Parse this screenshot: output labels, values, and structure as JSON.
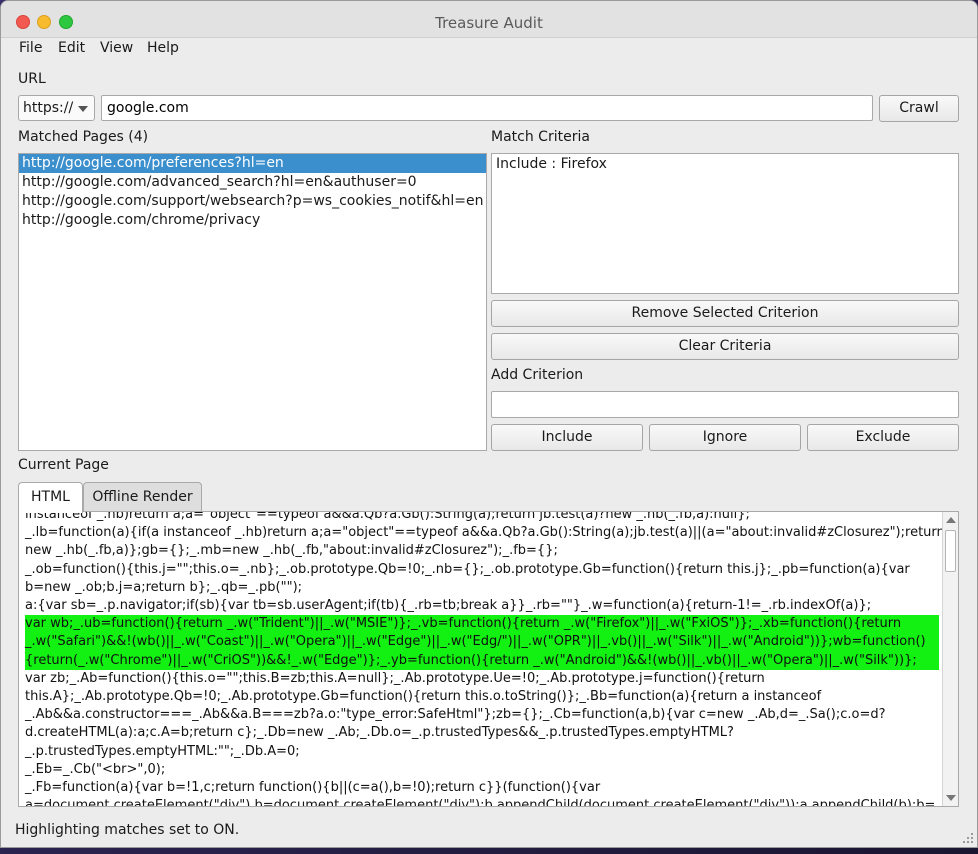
{
  "window": {
    "title": "Treasure Audit"
  },
  "menu": [
    "File",
    "Edit",
    "View",
    "Help"
  ],
  "url_section": {
    "label": "URL",
    "scheme": "https://",
    "value": "google.com",
    "crawl_label": "Crawl"
  },
  "matched": {
    "label": "Matched Pages (4)",
    "items": [
      "http://google.com/preferences?hl=en",
      "http://google.com/advanced_search?hl=en&authuser=0",
      "http://google.com/support/websearch?p=ws_cookies_notif&hl=en",
      "http://google.com/chrome/privacy"
    ],
    "selected_index": 0
  },
  "criteria": {
    "label": "Match Criteria",
    "items": [
      "Include : Firefox"
    ],
    "remove_label": "Remove Selected Criterion",
    "clear_label": "Clear Criteria",
    "add_label": "Add Criterion",
    "add_value": "",
    "include_label": "Include",
    "ignore_label": "Ignore",
    "exclude_label": "Exclude"
  },
  "current_page": {
    "label": "Current Page",
    "tabs": [
      "HTML",
      "Offline Render"
    ],
    "active_tab": "HTML",
    "code_before": "instanceof _.hb)return a;a=\"object\"==typeof a&&a.Qb?a.Gb():String(a);return jb.test(a)?new _.hb(_.fb,a):null};\n_.lb=function(a){if(a instanceof _.hb)return a;a=\"object\"==typeof a&&a.Qb?a.Gb():String(a);jb.test(a)||(a=\"about:invalid#zClosurez\");return\nnew _.hb(_.fb,a)};gb={};_.mb=new _.hb(_.fb,\"about:invalid#zClosurez\");_.fb={};\n_.ob=function(){this.j=\"\";this.o=_.nb};_.ob.prototype.Qb=!0;_.nb={};_.ob.prototype.Gb=function(){return this.j};_.pb=function(a){var\nb=new _.ob;b.j=a;return b};_.qb=_.pb(\"\");\na:{var sb=_.p.navigator;if(sb){var tb=sb.userAgent;if(tb){_.rb=tb;break a}}_.rb=\"\"}_.w=function(a){return-1!=_.rb.indexOf(a)};",
    "code_highlight": "var wb;_.ub=function(){return _.w(\"Trident\")||_.w(\"MSIE\")};_.vb=function(){return _.w(\"Firefox\")||_.w(\"FxiOS\")};_.xb=function(){return\n_.w(\"Safari\")&&!(wb()||_.w(\"Coast\")||_.w(\"Opera\")||_.w(\"Edge\")||_.w(\"Edg/\")||_.w(\"OPR\")||_.vb()||_.w(\"Silk\")||_.w(\"Android\"))};wb=function()\n{return(_.w(\"Chrome\")||_.w(\"CriOS\"))&&!_.w(\"Edge\")};_.yb=function(){return _.w(\"Android\")&&!(wb()||_.vb()||_.w(\"Opera\")||_.w(\"Silk\"))};",
    "code_after": "var zb;_.Ab=function(){this.o=\"\";this.B=zb;this.A=null};_.Ab.prototype.Ue=!0;_.Ab.prototype.j=function(){return\nthis.A};_.Ab.prototype.Qb=!0;_.Ab.prototype.Gb=function(){return this.o.toString()};_.Bb=function(a){return a instanceof\n_.Ab&&a.constructor===_.Ab&&a.B===zb?a.o:\"type_error:SafeHtml\"};zb={};_.Cb=function(a,b){var c=new _.Ab,d=_.Sa();c.o=d?\nd.createHTML(a):a;c.A=b;return c};_.Db=new _.Ab;_.Db.o=_.p.trustedTypes&&_.p.trustedTypes.emptyHTML?\n_.p.trustedTypes.emptyHTML:\"\";_.Db.A=0;\n_.Eb=_.Cb(\"<br>\",0);\n_.Fb=function(a){var b=!1,c;return function(){b||(c=a(),b=!0);return c}}(function(){var\na=document.createElement(\"div\"),b=document.createElement(\"div\");b.appendChild(document.createElement(\"div\"));a.appendChild(b);b="
  },
  "status": "Highlighting matches set to ON."
}
